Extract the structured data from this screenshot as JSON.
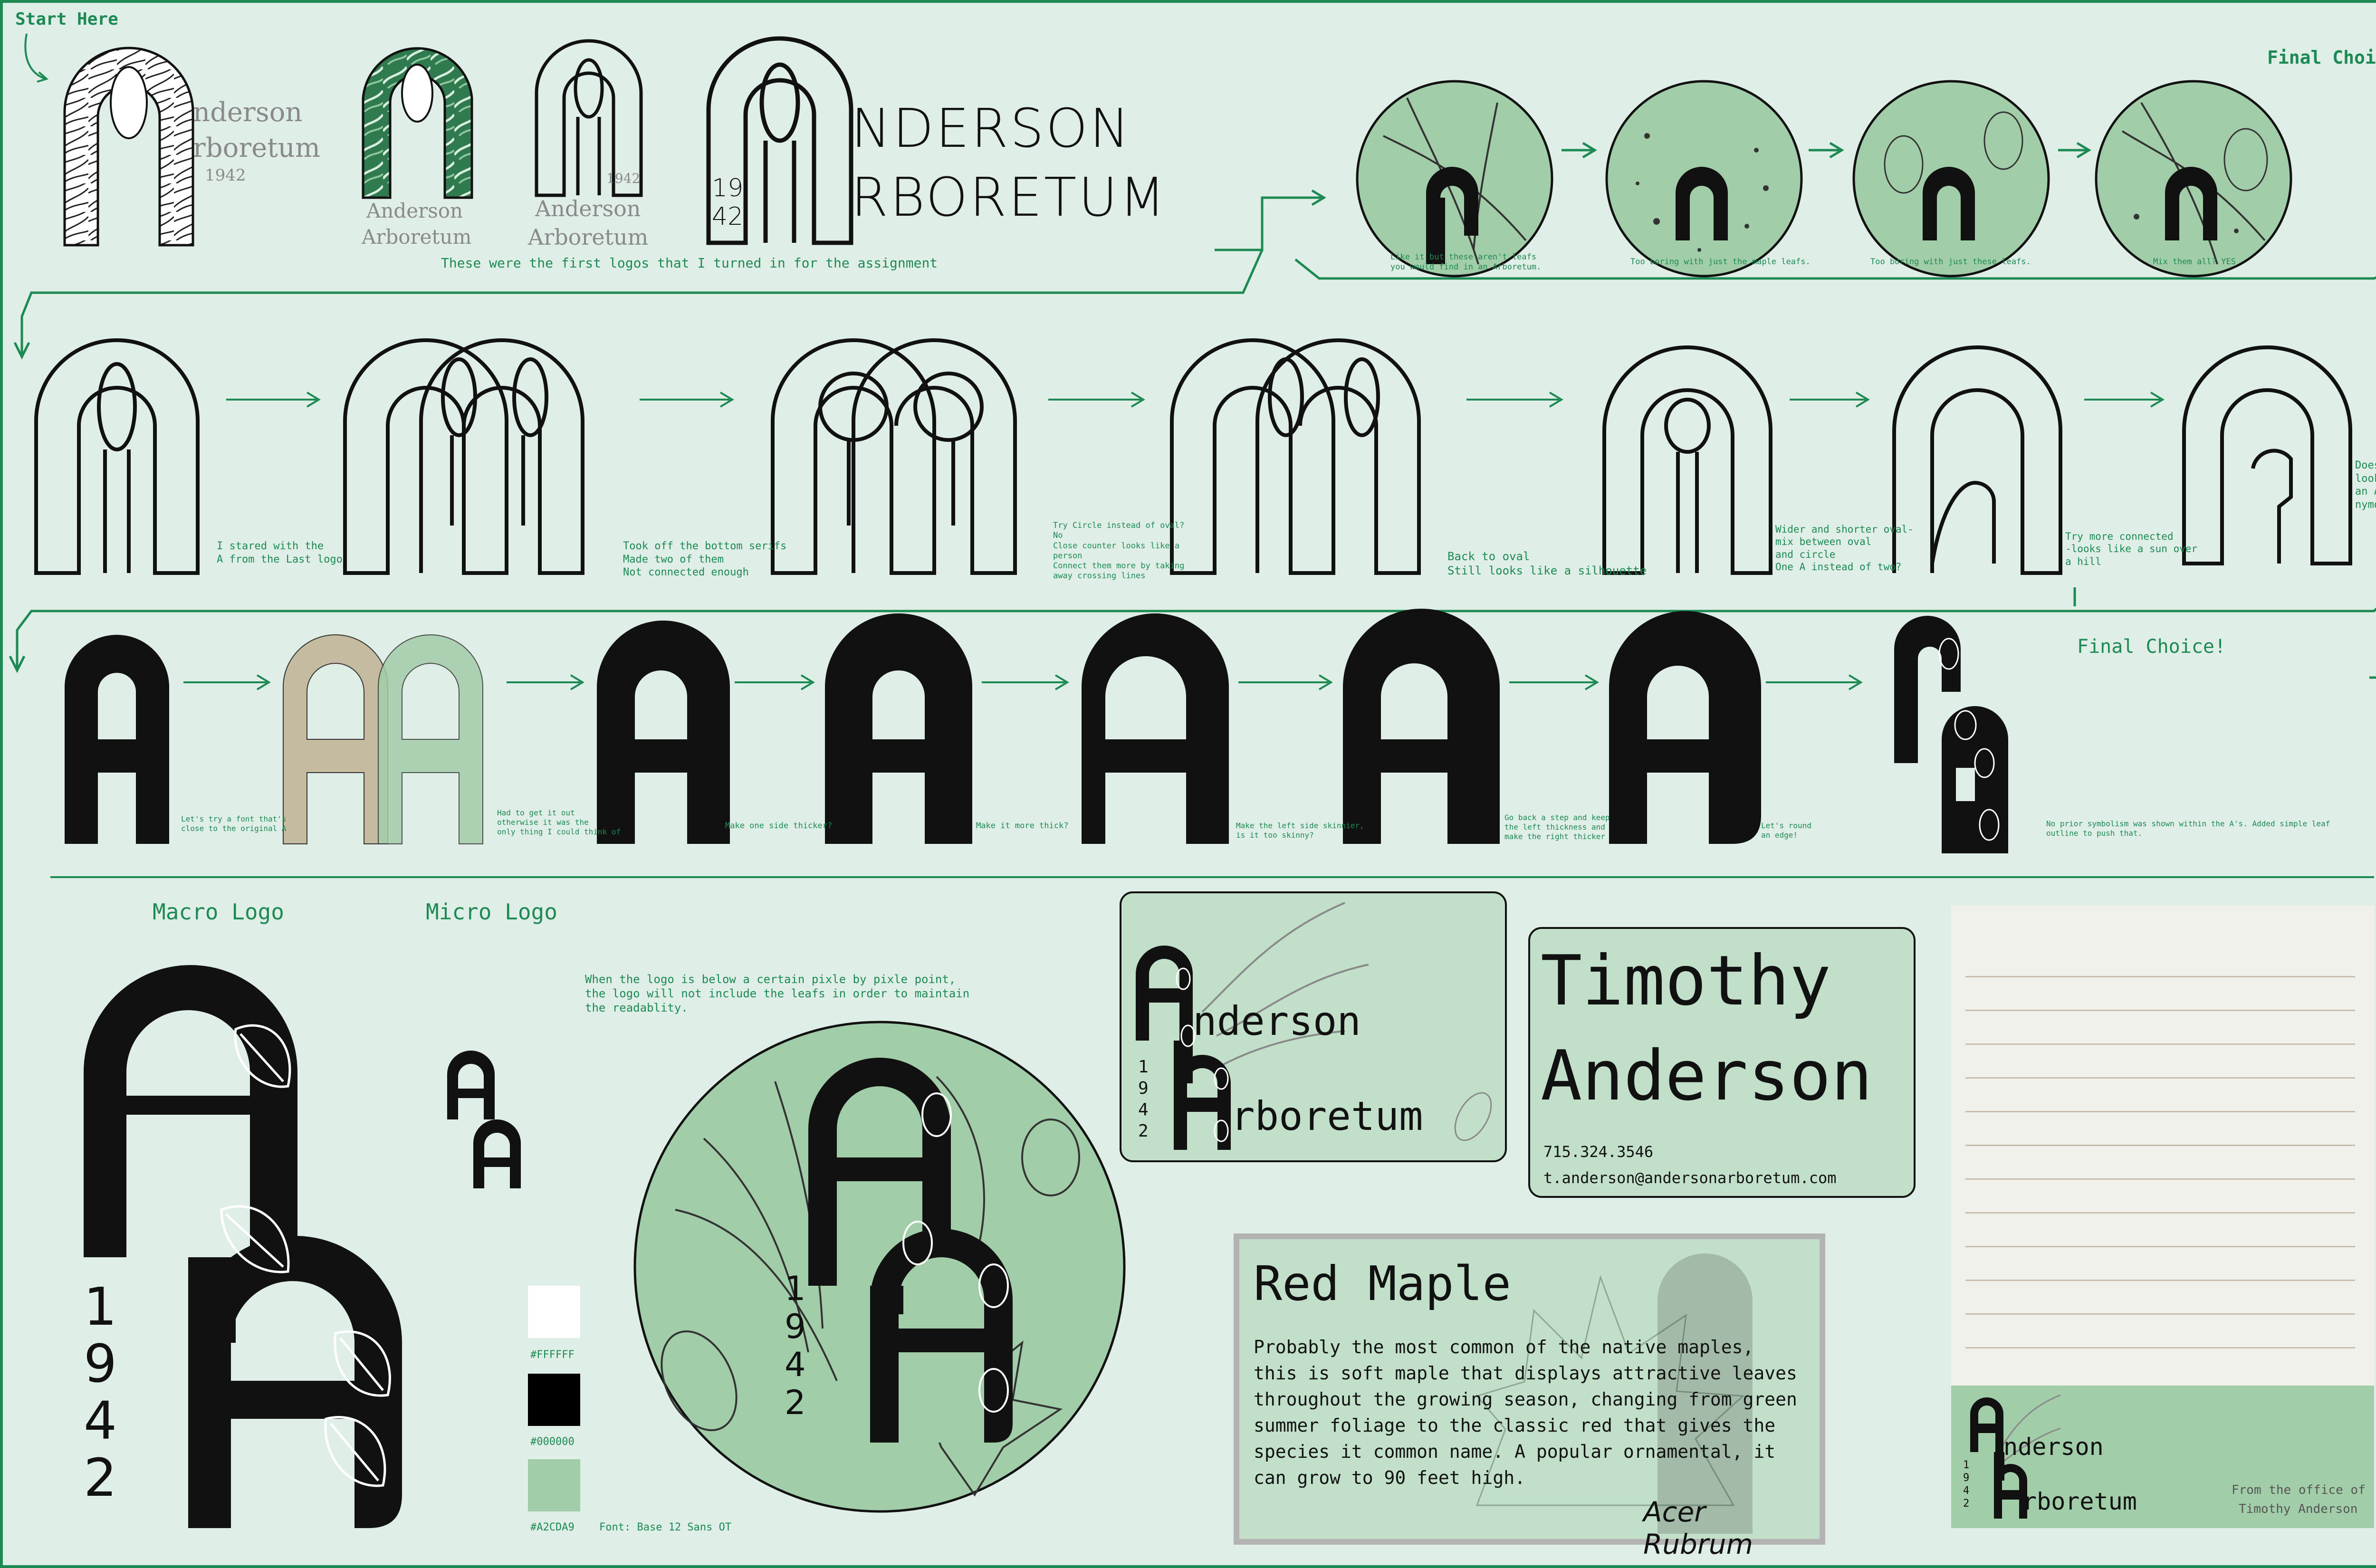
{
  "labels": {
    "start_here": "Start Here",
    "final_choice_top": "Final Choice!",
    "final_choice_mid": "Final Choice!",
    "first_logos_caption": "These were the first logos that I turned in for the assignment",
    "macro_logo": "Macro Logo",
    "micro_logo": "Micro Logo",
    "pixel_note": "When the logo is below a certain pixle by pixle point,\nthe logo will not include the leafs in order to maintain\nthe readablity.",
    "font_note": "Font: Base 12 Sans OT"
  },
  "first_logos": {
    "logo1_line1": "nderson",
    "logo1_line2": "rboretum",
    "logo1_year": "1942",
    "logo2_line1": "Anderson",
    "logo2_line2": "Arboretum",
    "logo3_line1": "Anderson",
    "logo3_line2": "Arboretum",
    "logo3_year": "1942",
    "logo4_line1": "NDERSON",
    "logo4_line2": "RBORETUM",
    "logo4_year1": "19",
    "logo4_year2": "42"
  },
  "leaf_captions": [
    "Like it but these aren't leafs\nyou would find in an Arboretum.",
    "Too boring with just the maple leafs.",
    "Too boring with just these leafs.",
    "Mix them all? YES"
  ],
  "row2_notes": [
    "I stared with the\nA from the Last logo",
    "Took off the bottom serifs\nMade two of them\nNot connected enough",
    "Try Circle instead of oval?\n  No\nClose counter looks like a\n  person\nConnect them more by taking\n  away crossing lines",
    "Back to oval\nStill looks like a silhouette",
    "Wider and shorter oval-\n  mix between oval\n  and circle\nOne A instead of two?",
    "Try more connected\n-looks like a sun over\n   a hill",
    "Doesn't\nlook like\nan A a\nnymore"
  ],
  "row3_notes": [
    "Let's try a font that's\nclose to the original A",
    "Had to get it out\notherwise it was the\nonly thing I could think of",
    "Make one side thicker?",
    "Make it more thick?",
    "Make the left side skinnier,\nis it too skinny?",
    "Go back a step and keep\nthe left thickness and\nmake the right thicker",
    "Let's round\nan edge!",
    "No prior symbolism was shown within the A's. Added simple leaf\noutline to push that."
  ],
  "row3_letter": "A",
  "macro_year": [
    "1",
    "9",
    "4",
    "2"
  ],
  "emblem_year": [
    "1",
    "9",
    "4",
    "2"
  ],
  "swatches": [
    {
      "label": "#FFFFFF",
      "color": "#FFFFFF"
    },
    {
      "label": "#000000",
      "color": "#000000"
    },
    {
      "label": "#A2CDA9",
      "color": "#A2CDA9"
    }
  ],
  "business_card": {
    "line1": "nderson",
    "line2": "rboretum",
    "year": [
      "1",
      "9",
      "4",
      "2"
    ]
  },
  "contact_card": {
    "first_name": "Timothy",
    "last_name": "Anderson",
    "phone": "715.324.3546",
    "email": "t.anderson@andersonarboretum.com"
  },
  "tree_card": {
    "title": "Red Maple",
    "body": "Probably the most common of the native maples, this is soft maple that displays attractive leaves throughout the growing season, changing from green summer foliage to the classic red that gives the species it common name. A popular ornamental, it can grow to 90 feet high.",
    "latin": "Acer Rubrum"
  },
  "letterhead": {
    "line1": "nderson",
    "line2": "rboretum",
    "year": [
      "1",
      "9",
      "4",
      "2"
    ],
    "footer_line1": "From the office of",
    "footer_line2": "Timothy Anderson"
  },
  "colors": {
    "background": "#e0eee8",
    "accent": "#1c8a52",
    "mint": "#a2cda9",
    "card": "#c2e0c9",
    "tan": "#c5bba0"
  }
}
